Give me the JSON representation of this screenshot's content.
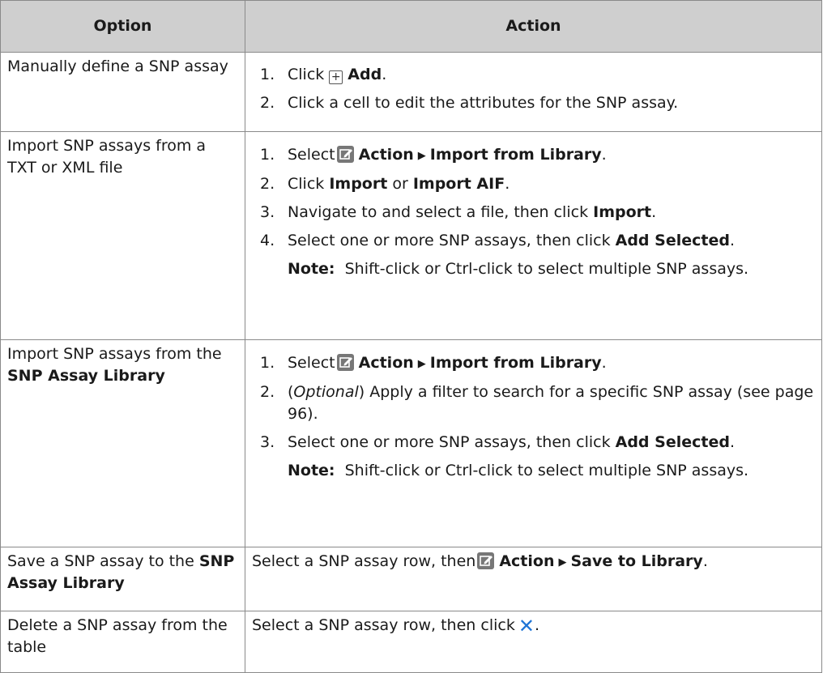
{
  "header": {
    "option": "Option",
    "action": "Action"
  },
  "rows": {
    "r0": {
      "option": "Manually define a SNP assay",
      "s1_click": "Click",
      "s1_add": "Add",
      "s2": "Click a cell to edit the attributes for the SNP assay."
    },
    "r1": {
      "option": "Import SNP assays from a TXT or XML file",
      "s1_select": "Select",
      "s1_action": "Action",
      "s1_import_lib": "Import from Library",
      "s2_click": "Click",
      "s2_import": "Import",
      "s2_or": "or",
      "s2_import_aif": "Import AIF",
      "s3_text": "Navigate to and select a file, then click",
      "s3_import": "Import",
      "s4_text": "Select one or more SNP assays, then click",
      "s4_add_selected": "Add Selected",
      "note_label": "Note:",
      "note_text": "Shift-click or Ctrl-click to select multiple SNP assays."
    },
    "r2": {
      "option_prefix": "Import SNP assays from the",
      "option_bold": "SNP Assay Library",
      "s1_select": "Select",
      "s1_action": "Action",
      "s1_import_lib": "Import from Library",
      "s2_optional": "Optional",
      "s2_text": "Apply a filter to search for a specific SNP assay (see page 96).",
      "s3_text": "Select one or more SNP assays, then click",
      "s3_add_selected": "Add Selected",
      "note_label": "Note:",
      "note_text": "Shift-click or Ctrl-click to select multiple SNP assays."
    },
    "r3": {
      "option_prefix": "Save a SNP assay to the",
      "option_bold": "SNP Assay Library",
      "text": "Select a SNP assay row, then",
      "action": "Action",
      "save_lib": "Save to Library"
    },
    "r4": {
      "option": "Delete a SNP assay from the table",
      "text": "Select a SNP assay row, then click"
    }
  },
  "icons": {
    "plus": "plus-box-icon",
    "edit": "edit-pencil-icon",
    "arrow": "triangle-right-icon",
    "close": "close-x-icon"
  },
  "colors": {
    "header_bg": "#cfcfcf",
    "close_icon": "#1e74d6"
  }
}
